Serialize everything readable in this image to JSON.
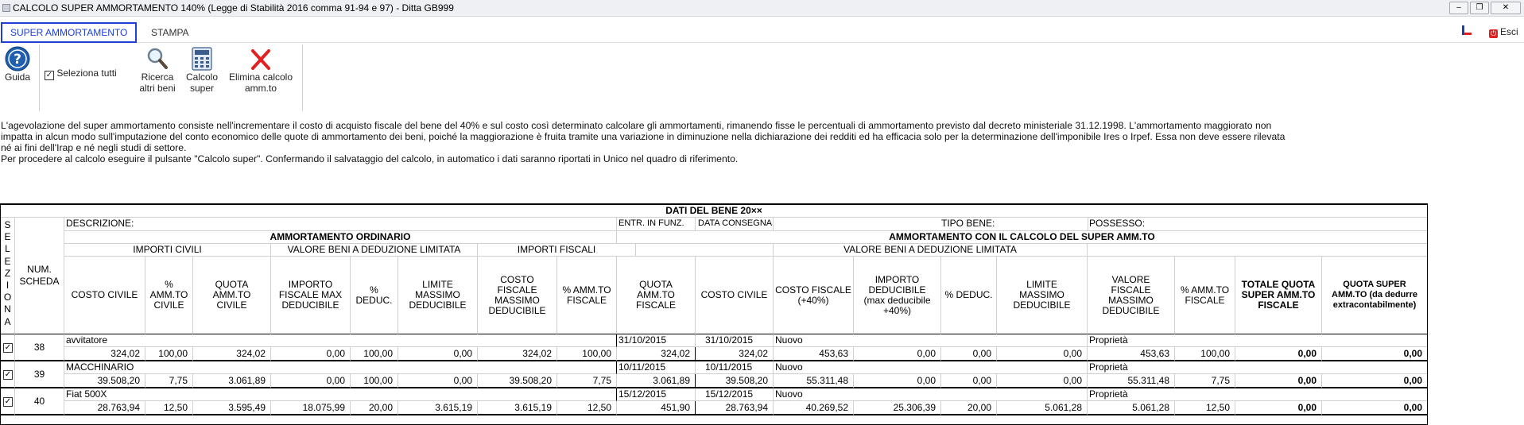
{
  "window": {
    "title": "CALCOLO SUPER AMMORTAMENTO 140% (Legge di Stabilità 2016 comma 91-94 e 97) - Ditta GB999"
  },
  "tabs": [
    {
      "label": "SUPER AMMORTAMENTO"
    },
    {
      "label": "STAMPA"
    }
  ],
  "topright": {
    "esci": "Esci"
  },
  "toolbar": {
    "guida": "Guida",
    "seleziona_tutti": "Seleziona tutti",
    "ricerca_1": "Ricerca",
    "ricerca_2": "altri beni",
    "calcolo_1": "Calcolo",
    "calcolo_2": "super",
    "elimina_1": "Elimina calcolo",
    "elimina_2": "amm.to"
  },
  "description": {
    "line1": "L'agevolazione del super ammortamento consiste nell'incrementare il costo di acquisto fiscale del bene del 40% e sul costo così determinato calcolare gli ammortamenti, rimanendo fisse le percentuali di ammortamento previsto dal decreto ministeriale 31.12.1998. L'ammortamento maggiorato non",
    "line2": "impatta in alcun modo sull'imputazione del conto economico delle quote di ammortamento dei beni, poiché la maggiorazione è fruita tramite una variazione in diminuzione nella dichiarazione dei redditi ed ha efficacia solo per la determinazione dell'imponibile Ires o Irpef. Essa non deve essere rilevata",
    "line3": "né ai fini dell'Irap e né negli studi di settore.",
    "line4": "Per procedere al calcolo eseguire il pulsante \"Calcolo super\". Confermando il salvataggio del calcolo, in automatico i dati saranno riportati in Unico nel quadro di riferimento."
  },
  "table": {
    "title": "DATI DEL BENE 20××",
    "seleziona": [
      "S",
      "E",
      "L",
      "E",
      "Z",
      "I",
      "O",
      "N",
      "A"
    ],
    "num_scheda_1": "NUM.",
    "num_scheda_2": "SCHEDA",
    "descrizione": "DESCRIZIONE:",
    "entr": "ENTR. IN FUNZ.",
    "data_consegna": "DATA CONSEGNA",
    "tipo_bene": "TIPO BENE:",
    "possesso": "POSSESSO:",
    "amm_ordinario": "AMMORTAMENTO ORDINARIO",
    "amm_super": "AMMORTAMENTO CON IL CALCOLO DEL SUPER AMM.TO",
    "importi_civili": "IMPORTI CIVILI",
    "valore_beni_1": "VALORE BENI A DEDUZIONE LIMITATA",
    "importi_fiscali": "IMPORTI FISCALI",
    "valore_beni_2": "VALORE BENI A DEDUZIONE LIMITATA",
    "cols": {
      "costo_civile": "COSTO CIVILE",
      "amm_civile": [
        "%",
        "AMM.TO",
        "CIVILE"
      ],
      "quota_civile": [
        "QUOTA",
        "AMM.TO",
        "CIVILE"
      ],
      "importo_fiscale_max": [
        "IMPORTO",
        "FISCALE MAX",
        "DEDUCIBILE"
      ],
      "deduc": [
        "%",
        "DEDUC."
      ],
      "limite_massimo": [
        "LIMITE",
        "MASSIMO",
        "DEDUCIBILE"
      ],
      "costo_fiscale_max": [
        "COSTO",
        "FISCALE",
        "MASSIMO",
        "DEDUCIBILE"
      ],
      "amm_fiscale": [
        "% AMM.TO",
        "FISCALE"
      ],
      "quota_fiscale": [
        "QUOTA",
        "AMM.TO",
        "FISCALE"
      ],
      "costo_civile_2": "COSTO CIVILE",
      "costo_fiscale_40": [
        "COSTO FISCALE",
        "(+40%)"
      ],
      "importo_deducibile": [
        "IMPORTO",
        "DEDUCIBILE",
        "(max deducibile",
        "+40%)"
      ],
      "deduc_2": "% DEDUC.",
      "limite_massimo_2": [
        "LIMITE",
        "MASSIMO",
        "DEDUCIBILE"
      ],
      "valore_fiscale_max": [
        "VALORE",
        "FISCALE",
        "MASSIMO",
        "DEDUCIBILE"
      ],
      "amm_fiscale_2": [
        "% AMM.TO",
        "FISCALE"
      ],
      "totale_quota": [
        "TOTALE QUOTA",
        "SUPER AMM.TO",
        "FISCALE"
      ],
      "quota_super": [
        "QUOTA SUPER",
        "AMM.TO (da dedurre",
        "extracontabilmente)"
      ]
    },
    "rows": [
      {
        "checked": true,
        "num": "38",
        "descrizione": "avvitatore",
        "entr": "31/10/2015",
        "consegna": "31/10/2015",
        "tipo": "Nuovo",
        "possesso": "Proprietà",
        "values": [
          "324,02",
          "100,00",
          "324,02",
          "0,00",
          "100,00",
          "0,00",
          "324,02",
          "100,00",
          "324,02",
          "324,02",
          "453,63",
          "0,00",
          "0,00",
          "0,00",
          "453,63",
          "100,00",
          "0,00",
          "0,00"
        ]
      },
      {
        "checked": true,
        "num": "39",
        "descrizione": "MACCHINARIO",
        "entr": "10/11/2015",
        "consegna": "10/11/2015",
        "tipo": "Nuovo",
        "possesso": "Proprietà",
        "values": [
          "39.508,20",
          "7,75",
          "3.061,89",
          "0,00",
          "100,00",
          "0,00",
          "39.508,20",
          "7,75",
          "3.061,89",
          "39.508,20",
          "55.311,48",
          "0,00",
          "0,00",
          "0,00",
          "55.311,48",
          "7,75",
          "0,00",
          "0,00"
        ]
      },
      {
        "checked": true,
        "num": "40",
        "descrizione": "Fiat 500X",
        "entr": "15/12/2015",
        "consegna": "15/12/2015",
        "tipo": "Nuovo",
        "possesso": "Proprietà",
        "values": [
          "28.763,94",
          "12,50",
          "3.595,49",
          "18.075,99",
          "20,00",
          "3.615,19",
          "3.615,19",
          "12,50",
          "451,90",
          "28.763,94",
          "40.269,52",
          "25.306,39",
          "20,00",
          "5.061,28",
          "5.061,28",
          "12,50",
          "0,00",
          "0,00"
        ]
      }
    ]
  },
  "colors": {
    "tab_active": "#1d3fd6",
    "close_icon": "#e02222",
    "help_icon": "#1f5fb0"
  }
}
